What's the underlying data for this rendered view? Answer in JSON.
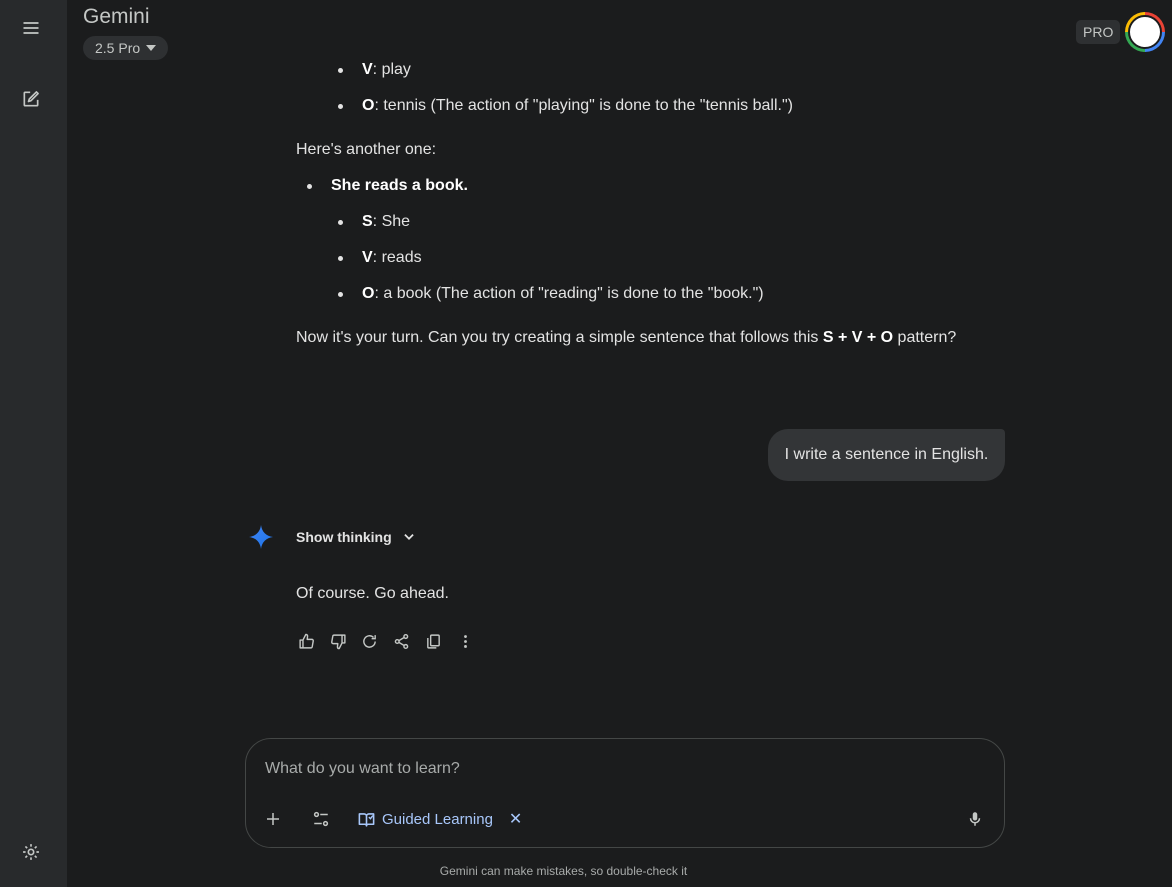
{
  "app": {
    "title": "Gemini",
    "model": "2.5 Pro",
    "badge": "PRO"
  },
  "sidebar": {
    "icons": [
      "menu-icon",
      "new-chat-icon",
      "settings-icon"
    ]
  },
  "conversation": {
    "prev_items": [
      {
        "label": "V",
        "text": ": play"
      },
      {
        "label": "O",
        "text": ": tennis (The action of \"playing\" is done to the \"tennis ball.\")"
      }
    ],
    "intro": "Here's another one:",
    "example_sentence": "She reads a book.",
    "example_items": [
      {
        "label": "S",
        "text": ": She"
      },
      {
        "label": "V",
        "text": ": reads"
      },
      {
        "label": "O",
        "text": ": a book (The action of \"reading\" is done to the \"book.\")"
      }
    ],
    "prompt_prefix": "Now it's your turn. Can you try creating a simple sentence that follows this ",
    "prompt_pattern": "S + V + O",
    "prompt_suffix": " pattern?",
    "user_message": "I write a sentence in English.",
    "show_thinking": "Show thinking",
    "reply": "Of course. Go ahead."
  },
  "actions": [
    "thumbs-up-icon",
    "thumbs-down-icon",
    "regenerate-icon",
    "share-icon",
    "copy-icon",
    "more-icon"
  ],
  "input": {
    "placeholder": "What do you want to learn?",
    "tool_chip": "Guided Learning",
    "chip_close": "✕"
  },
  "footer": {
    "disclaimer": "Gemini can make mistakes, so double-check it"
  },
  "colors": {
    "background": "#1b1c1d",
    "sidebar": "#282a2c",
    "accent": "#a8c7fa",
    "gemini_star": "#4285f4"
  }
}
